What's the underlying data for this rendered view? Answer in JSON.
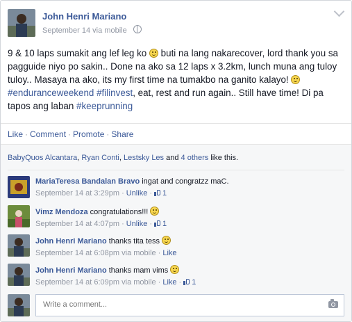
{
  "post": {
    "author": "John Henri Mariano",
    "date": "September 14",
    "via": "via mobile",
    "text": {
      "p1": "9 & 10 laps sumakit ang lef leg ko ",
      "p2": " buti na lang nakarecover, lord thank you sa pagguide niyo po sakin.. Done na ako sa 12 laps x 3.2km, lunch muna ang tuloy tuloy.. Masaya na ako, its my first time na tumakbo na ganito kalayo! ",
      "tag1": "#enduranceweekend",
      "tag2": "#filinvest",
      "p3": ", eat, rest and run again.. Still have time! Di pa tapos ang laban ",
      "tag3": "#keeprunning"
    }
  },
  "actions": {
    "like": "Like",
    "comment": "Comment",
    "promote": "Promote",
    "share": "Share"
  },
  "likes": {
    "names": [
      "BabyQuos Alcantara",
      "Ryan Conti",
      "Lestsky Les"
    ],
    "and": "and",
    "others": "4 others",
    "suffix": "like this."
  },
  "comments": [
    {
      "name": "MariaTeresa Bandalan Bravo",
      "text": "ingat and congratzz maC.",
      "time": "September 14 at 3:29pm",
      "action": "Unlike",
      "likes": "1"
    },
    {
      "name": "Vimz Mendoza",
      "text": "congratulations!!!",
      "time": "September 14 at 4:07pm",
      "action": "Unlike",
      "likes": "1"
    },
    {
      "name": "John Henri Mariano",
      "text": "thanks tita tess",
      "time": "September 14 at 6:08pm via mobile",
      "action": "Like"
    },
    {
      "name": "John Henri Mariano",
      "text": "thanks mam vims",
      "time": "September 14 at 6:09pm via mobile",
      "action": "Like",
      "likes": "1"
    }
  ],
  "composer": {
    "placeholder": "Write a comment..."
  },
  "icons": {
    "globe": "globe-icon",
    "chevron": "chevron-down-icon",
    "smiley": "smiley-icon",
    "thumb": "thumbs-up-icon",
    "camera": "camera-icon"
  },
  "colors": {
    "link": "#3b5998",
    "meta": "#9197a3",
    "feedback_bg": "#f6f7f8"
  }
}
